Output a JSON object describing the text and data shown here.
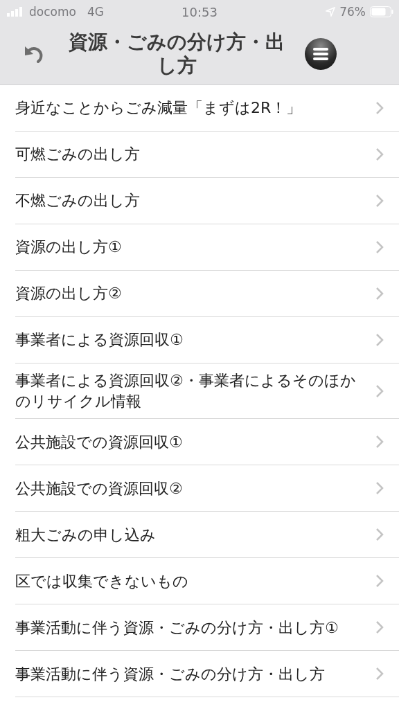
{
  "status_bar": {
    "carrier": "docomo",
    "network": "4G",
    "time": "10:53",
    "battery": "76%"
  },
  "header": {
    "title": "資源・ごみの分け方・出し方"
  },
  "items": [
    {
      "label": "身近なことからごみ減量「まずは2R！」"
    },
    {
      "label": "可燃ごみの出し方"
    },
    {
      "label": "不燃ごみの出し方"
    },
    {
      "label": "資源の出し方①"
    },
    {
      "label": "資源の出し方②"
    },
    {
      "label": "事業者による資源回収①"
    },
    {
      "label": "事業者による資源回収②・事業者によるそのほかのリサイクル情報"
    },
    {
      "label": "公共施設での資源回収①"
    },
    {
      "label": "公共施設での資源回収②"
    },
    {
      "label": "粗大ごみの申し込み"
    },
    {
      "label": "区では収集できないもの"
    },
    {
      "label": "事業活動に伴う資源・ごみの分け方・出し方①"
    },
    {
      "label": "事業活動に伴う資源・ごみの分け方・出し方"
    }
  ]
}
